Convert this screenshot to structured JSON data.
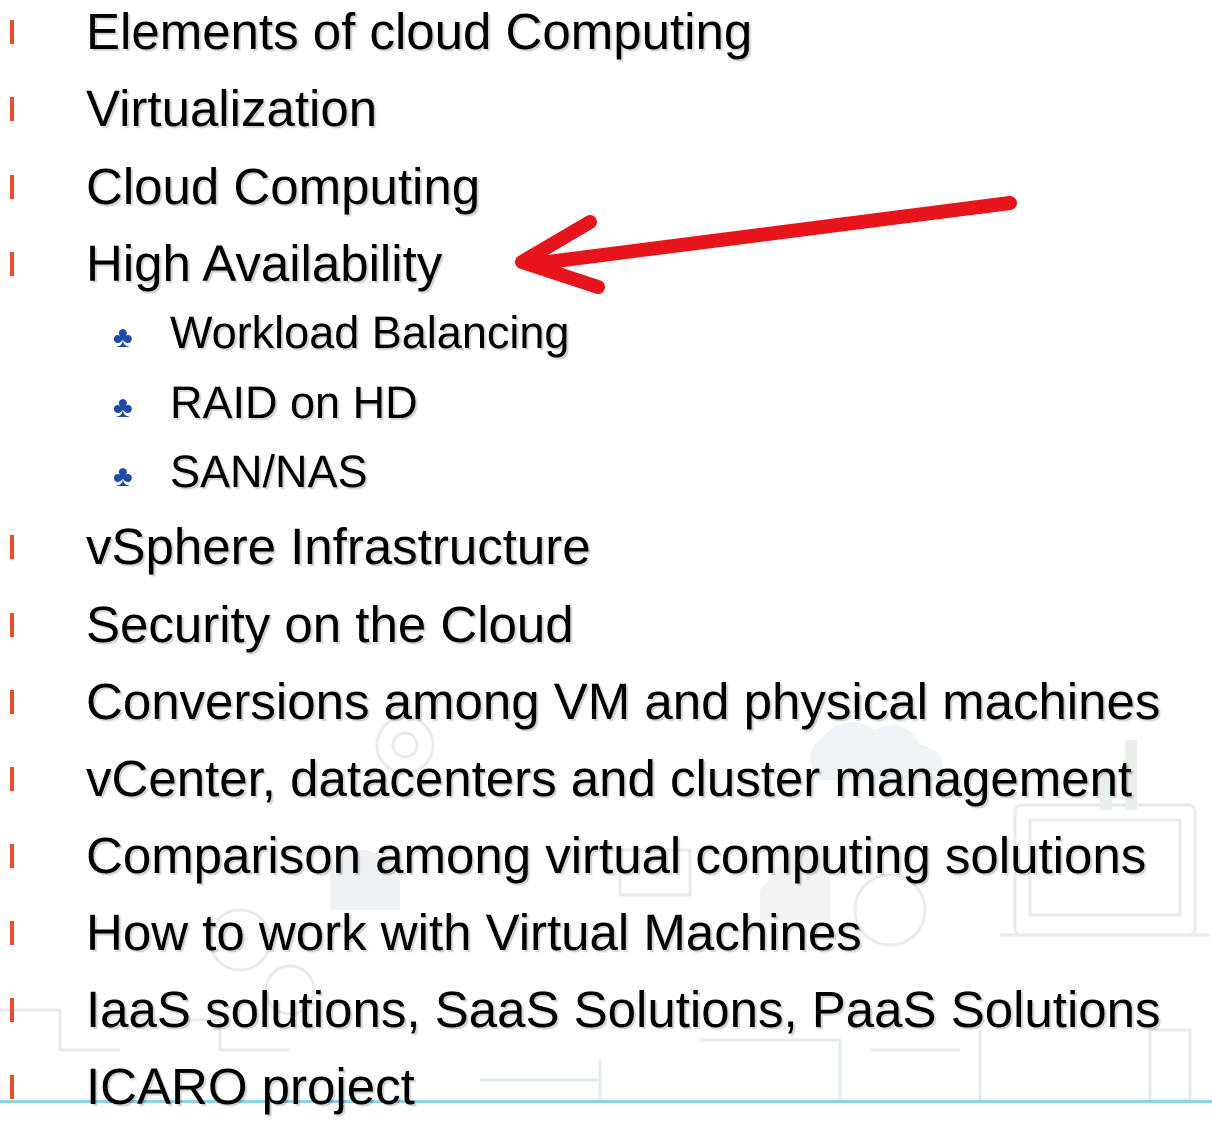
{
  "slide": {
    "items": [
      {
        "label": "Elements of cloud Computing"
      },
      {
        "label": "Virtualization"
      },
      {
        "label": "Cloud Computing"
      },
      {
        "label": "High Availability"
      },
      {
        "label": "vSphere Infrastructure"
      },
      {
        "label": "Security on the Cloud"
      },
      {
        "label": "Conversions among VM and physical machines"
      },
      {
        "label": "vCenter, datacenters and cluster management"
      },
      {
        "label": "Comparison among virtual computing solutions"
      },
      {
        "label": "How to work with Virtual Machines"
      },
      {
        "label": "IaaS solutions, SaaS Solutions, PaaS Solutions"
      },
      {
        "label": "ICARO project"
      }
    ],
    "subitems": [
      {
        "label": "Workload Balancing"
      },
      {
        "label": "RAID on HD"
      },
      {
        "label": "SAN/NAS"
      }
    ],
    "sub_bullet_glyph": "♣",
    "colors": {
      "bullet": "#e8502a",
      "sub_bullet": "#1e4aa8",
      "arrow": "#e8141c",
      "text": "#000000"
    }
  }
}
